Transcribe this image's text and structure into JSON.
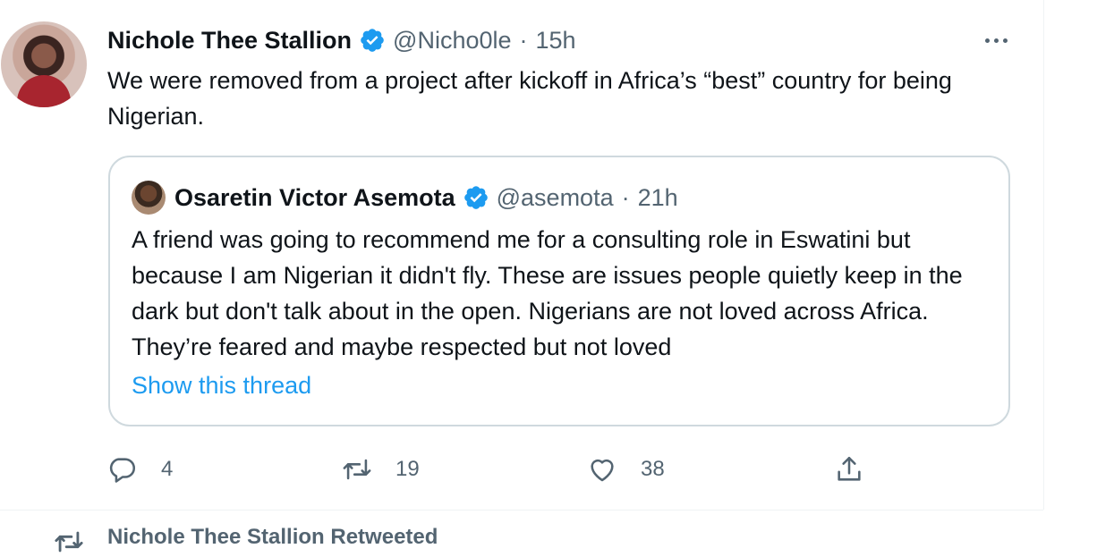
{
  "tweet": {
    "author_name": "Nichole Thee Stallion",
    "handle": "@Nicho0le",
    "separator": "·",
    "time": "15h",
    "text": "We were removed from a project after kickoff in Africa’s “best” country for being Nigerian.",
    "verified_icon": "verified-badge-icon",
    "more_icon": "more-options-icon"
  },
  "quote": {
    "author_name": "Osaretin Victor Asemota",
    "handle": "@asemota",
    "separator": "·",
    "time": "21h",
    "text": "A friend was going to recommend me for a consulting role in Eswatini but because I am Nigerian it didn't fly. These are issues people quietly keep in the dark but don't talk about in the open. Nigerians are not loved across Africa. They’re feared and maybe respected but not loved",
    "link": "Show this thread"
  },
  "actions": {
    "replies": "4",
    "retweets": "19",
    "likes": "38",
    "reply_icon": "reply-icon",
    "retweet_icon": "retweet-icon",
    "like_icon": "heart-icon",
    "share_icon": "share-icon"
  },
  "next": {
    "text": "Nichole Thee Stallion Retweeted"
  },
  "colors": {
    "text": "#0f1419",
    "secondary": "#536471",
    "link": "#1d9bf0",
    "verified": "#1d9bf0",
    "border": "#cfd9de"
  }
}
